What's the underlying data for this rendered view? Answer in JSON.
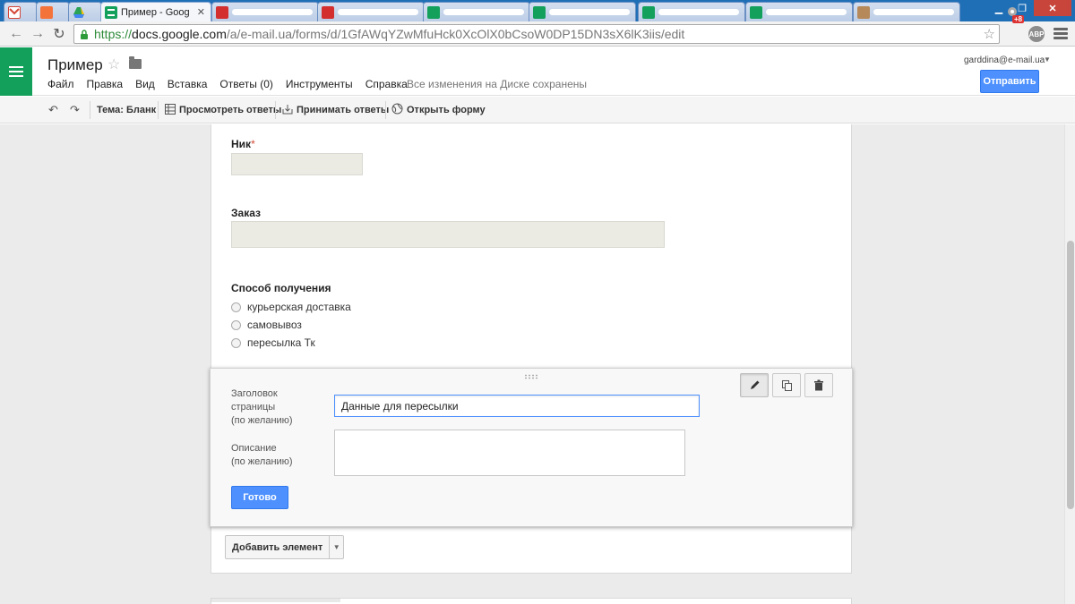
{
  "browser": {
    "tabs": [
      {
        "title": "",
        "favicon_color": "#d44638",
        "active": false
      },
      {
        "title": "",
        "favicon_color": "#f4733b",
        "active": false
      },
      {
        "title": "",
        "favicon_color": "#2aa356",
        "active": false
      },
      {
        "title": "Пример - Goog",
        "favicon_color": "#13a05b",
        "active": true
      },
      {
        "title": "",
        "favicon_color": "#d32f2f",
        "active": false
      },
      {
        "title": "",
        "favicon_color": "#d32f2f",
        "active": false
      },
      {
        "title": "",
        "favicon_color": "#13a05b",
        "active": false
      },
      {
        "title": "",
        "favicon_color": "#13a05b",
        "active": false
      },
      {
        "title": "",
        "favicon_color": "#13a05b",
        "active": false
      },
      {
        "title": "",
        "favicon_color": "#13a05b",
        "active": false
      },
      {
        "title": "",
        "favicon_color": "#b5895a",
        "active": false
      }
    ],
    "url": {
      "scheme": "https://",
      "host": "docs.google.com",
      "path": "/a/e-mail.ua/forms/d/1GfAWqYZwMfuHck0XcOlX0bCsoW0DP15DN3sX6lK3iis/edit"
    },
    "extension_badge": "+8",
    "abp_label": "ABP"
  },
  "header": {
    "title": "Пример",
    "menu": [
      "Файл",
      "Правка",
      "Вид",
      "Вставка",
      "Ответы (0)",
      "Инструменты",
      "Справка"
    ],
    "save_status": "Все изменения на Диске сохранены",
    "user_email": "garddina@e-mail.ua",
    "send_button": "Отправить"
  },
  "toolbar": {
    "theme": "Тема: Бланк",
    "view_responses": "Просмотреть ответы",
    "accept_responses": "Принимать ответы",
    "open_form": "Открыть форму"
  },
  "form": {
    "questions": [
      {
        "title": "Ник",
        "required_mark": "*"
      },
      {
        "title": "Заказ"
      },
      {
        "title": "Способ получения",
        "options": [
          "курьерская доставка",
          "самовывоз",
          "пересылка Тк"
        ]
      }
    ],
    "page_break": {
      "title_label": [
        "Заголовок",
        "страницы",
        "(по желанию)"
      ],
      "title_value": "Данные для пересылки",
      "description_label": [
        "Описание",
        "(по желанию)"
      ],
      "description_value": "",
      "done_button": "Готово"
    },
    "add_element": "Добавить элемент"
  },
  "colors": {
    "chrome_frame": "#1f6fb7",
    "forms_green": "#13a05b",
    "primary_button": "#4d90fe",
    "required": "#d14836"
  }
}
